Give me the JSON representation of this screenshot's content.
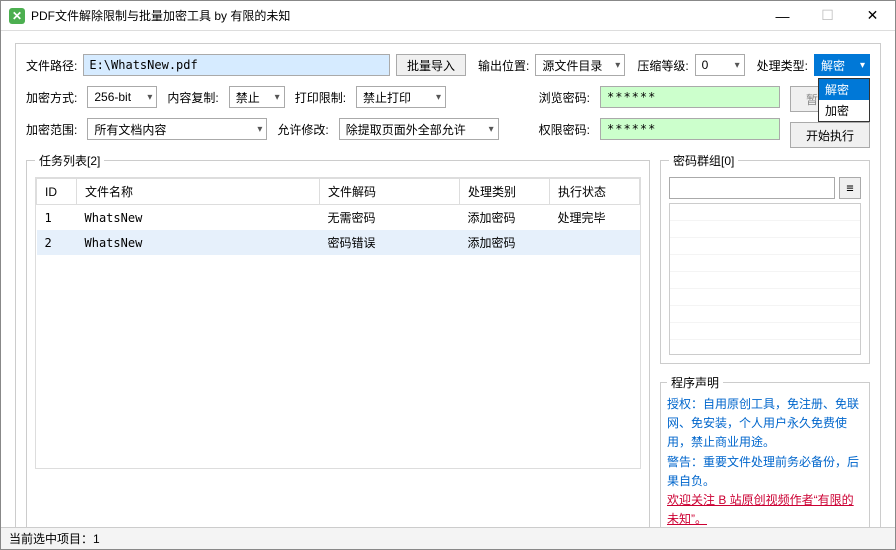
{
  "window": {
    "title": "PDF文件解除限制与批量加密工具 by 有限的未知"
  },
  "toolbar": {
    "filepath_label": "文件路径:",
    "filepath_value": "E:\\WhatsNew.pdf",
    "batch_import": "批量导入",
    "output_label": "输出位置:",
    "output_value": "源文件目录",
    "compress_label": "压缩等级:",
    "compress_value": "0",
    "proc_type_label": "处理类型:",
    "proc_type_value": "解密",
    "proc_type_options": {
      "decrypt": "解密",
      "encrypt": "加密"
    }
  },
  "encrypt": {
    "method_label": "加密方式:",
    "method_value": "256-bit",
    "copy_label": "内容复制:",
    "copy_value": "禁止",
    "print_label": "打印限制:",
    "print_value": "禁止打印",
    "scope_label": "加密范围:",
    "scope_value": "所有文档内容",
    "modify_label": "允许修改:",
    "modify_value": "除提取页面外全部允许",
    "view_pwd_label": "浏览密码:",
    "view_pwd_value": "******",
    "perm_pwd_label": "权限密码:",
    "perm_pwd_value": "******"
  },
  "buttons": {
    "pause": "暂停执行",
    "start": "开始执行"
  },
  "tasks": {
    "legend": "任务列表[2]",
    "headers": {
      "id": "ID",
      "name": "文件名称",
      "decode": "文件解码",
      "type": "处理类别",
      "state": "执行状态"
    },
    "rows": [
      {
        "id": "1",
        "name": "WhatsNew",
        "decode": "无需密码",
        "type": "添加密码",
        "state": "处理完毕"
      },
      {
        "id": "2",
        "name": "WhatsNew",
        "decode": "密码错误",
        "type": "添加密码",
        "state": ""
      }
    ]
  },
  "pwdgroup": {
    "legend": "密码群组[0]",
    "menu_btn": "≡"
  },
  "declaration": {
    "legend": "程序声明",
    "auth": "授权：自用原创工具，免注册、免联网、免安装，个人用户永久免费使用，禁止商业用途。",
    "warn": "警告：重要文件处理前务必备份，后果自负。",
    "link": "欢迎关注 B 站原创视频作者“有限的未知”。"
  },
  "statusbar": {
    "text": "当前选中项目：1"
  }
}
